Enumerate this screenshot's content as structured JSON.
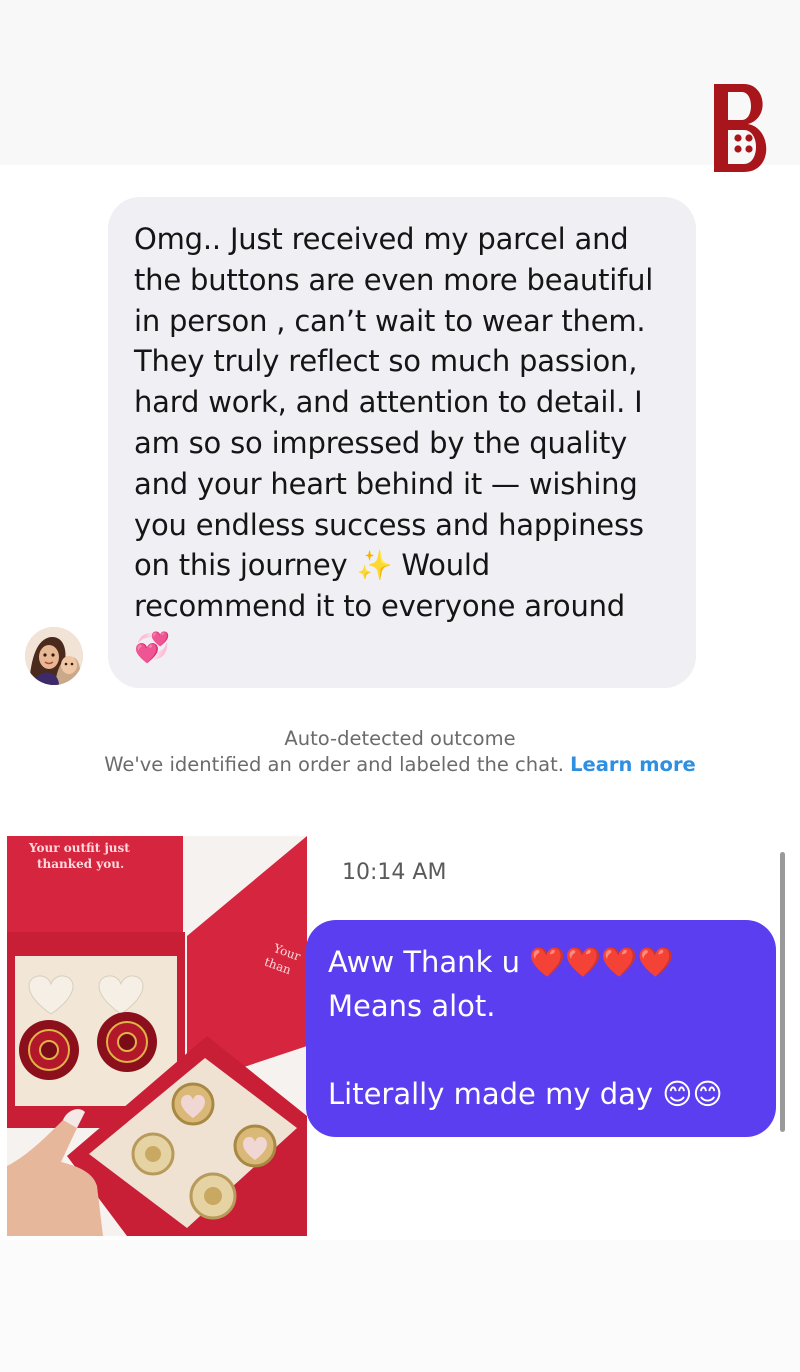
{
  "header": {
    "logo_letter": "B"
  },
  "incoming": {
    "text": "Omg.. Just received my parcel and\nthe buttons are even more beautiful\nin person , can’t wait to wear them.\nThey truly reflect so much passion,\nhard work, and attention to detail. I\nam so so impressed by the quality\nand your heart behind it — wishing\nyou endless success and happiness\non this journey ✨ Would\nrecommend it to everyone around\n💞"
  },
  "notice": {
    "title": "Auto-detected outcome",
    "body": "We've identified an order and labeled the chat.",
    "link": "Learn more"
  },
  "photo": {
    "box_text_left": "Your outfit just\nthanked you.",
    "box_text_right": "Your\nthan"
  },
  "outgoing": {
    "timestamp": "10:14 AM",
    "text": "Aww Thank u ❤️❤️❤️❤️\nMeans alot.\n\nLiterally made my day 😊😊"
  },
  "colors": {
    "incoming_bubble": "#efeff4",
    "outgoing_bubble": "#5a3ef0",
    "link": "#2f8fe0",
    "brand": "#a8161c"
  }
}
